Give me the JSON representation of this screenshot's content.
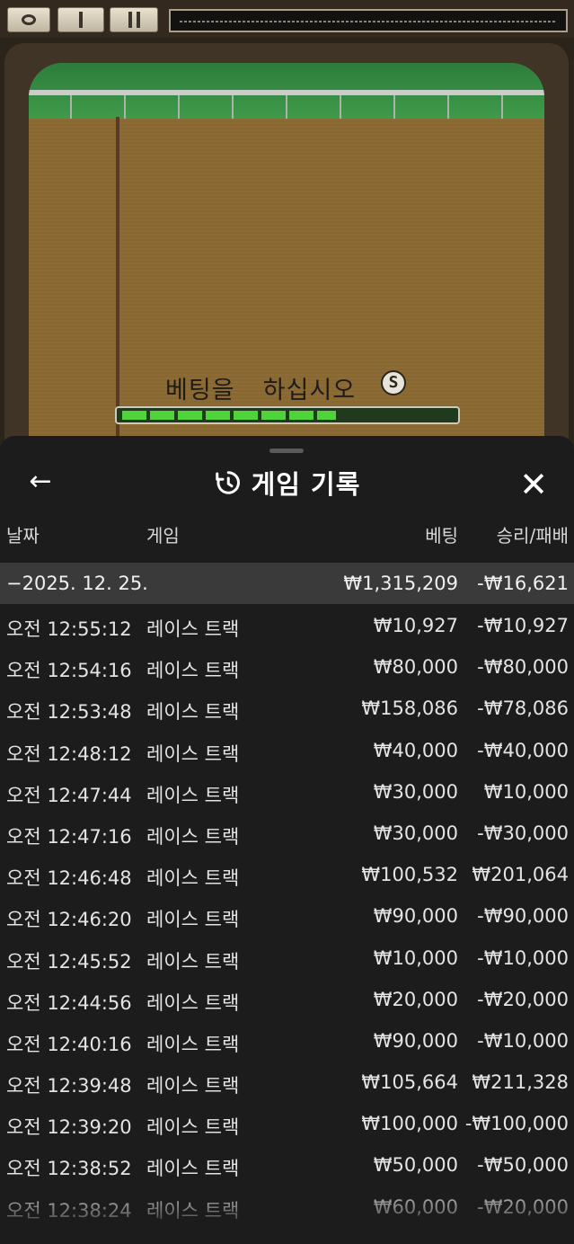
{
  "game": {
    "prompt": "베팅을 하십시오",
    "coin_symbol": "S",
    "progress_fraction": 0.64
  },
  "sheet": {
    "title": "게임 기록",
    "back_symbol": "←",
    "close_symbol": "✕",
    "columns": {
      "date": "날짜",
      "game": "게임",
      "bet": "베팅",
      "win_loss": "승리/패배"
    },
    "group": {
      "date": "−2025. 12. 25.",
      "bet": "₩1,315,209",
      "win_loss": "-₩16,621"
    },
    "rows": [
      {
        "time": "오전 12:55:12",
        "game": "레이스 트랙",
        "bet": "₩10,927",
        "result": "-₩10,927"
      },
      {
        "time": "오전 12:54:16",
        "game": "레이스 트랙",
        "bet": "₩80,000",
        "result": "-₩80,000"
      },
      {
        "time": "오전 12:53:48",
        "game": "레이스 트랙",
        "bet": "₩158,086",
        "result": "-₩78,086"
      },
      {
        "time": "오전 12:48:12",
        "game": "레이스 트랙",
        "bet": "₩40,000",
        "result": "-₩40,000"
      },
      {
        "time": "오전 12:47:44",
        "game": "레이스 트랙",
        "bet": "₩30,000",
        "result": "₩10,000"
      },
      {
        "time": "오전 12:47:16",
        "game": "레이스 트랙",
        "bet": "₩30,000",
        "result": "-₩30,000"
      },
      {
        "time": "오전 12:46:48",
        "game": "레이스 트랙",
        "bet": "₩100,532",
        "result": "₩201,064"
      },
      {
        "time": "오전 12:46:20",
        "game": "레이스 트랙",
        "bet": "₩90,000",
        "result": "-₩90,000"
      },
      {
        "time": "오전 12:45:52",
        "game": "레이스 트랙",
        "bet": "₩10,000",
        "result": "-₩10,000"
      },
      {
        "time": "오전 12:44:56",
        "game": "레이스 트랙",
        "bet": "₩20,000",
        "result": "-₩20,000"
      },
      {
        "time": "오전 12:40:16",
        "game": "레이스 트랙",
        "bet": "₩90,000",
        "result": "-₩10,000"
      },
      {
        "time": "오전 12:39:48",
        "game": "레이스 트랙",
        "bet": "₩105,664",
        "result": "₩211,328"
      },
      {
        "time": "오전 12:39:20",
        "game": "레이스 트랙",
        "bet": "₩100,000",
        "result": "-₩100,000"
      },
      {
        "time": "오전 12:38:52",
        "game": "레이스 트랙",
        "bet": "₩50,000",
        "result": "-₩50,000"
      },
      {
        "time": "오전 12:38:24",
        "game": "레이스 트랙",
        "bet": "₩60,000",
        "result": "-₩20,000"
      }
    ]
  }
}
